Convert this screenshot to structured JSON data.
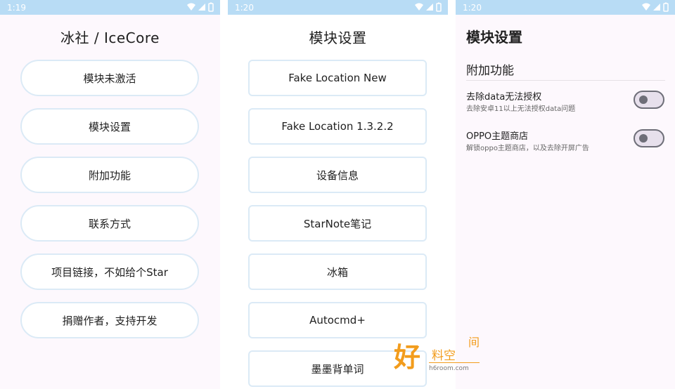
{
  "panel1": {
    "status_time": "1:19",
    "title": "冰社 / IceCore",
    "buttons": [
      "模块未激活",
      "模块设置",
      "附加功能",
      "联系方式",
      "项目链接，不如给个Star",
      "捐赠作者，支持开发"
    ]
  },
  "panel2": {
    "status_time": "1:20",
    "title": "模块设置",
    "buttons": [
      "Fake Location New",
      "Fake Location 1.3.2.2",
      "设备信息",
      "StarNote笔记",
      "冰箱",
      "Autocmd+",
      "墨墨背单词"
    ]
  },
  "panel3": {
    "status_time": "1:20",
    "title": "模块设置",
    "section": "附加功能",
    "settings": [
      {
        "title": "去除data无法授权",
        "desc": "去除安卓11以上无法授权data问题",
        "enabled": false
      },
      {
        "title": "OPPO主题商店",
        "desc": "解锁oppo主题商店，以及去除开屏广告",
        "enabled": false
      }
    ]
  },
  "status_icons": [
    "wifi-icon",
    "signal-icon",
    "battery-icon"
  ],
  "watermark": {
    "char1": "好",
    "char2": "料空",
    "char3": "间",
    "url": "h6room.com"
  },
  "colors": {
    "status_bar": "#b8dcf5",
    "button_border": "#dbeaf6",
    "watermark": "#f29c1c"
  }
}
